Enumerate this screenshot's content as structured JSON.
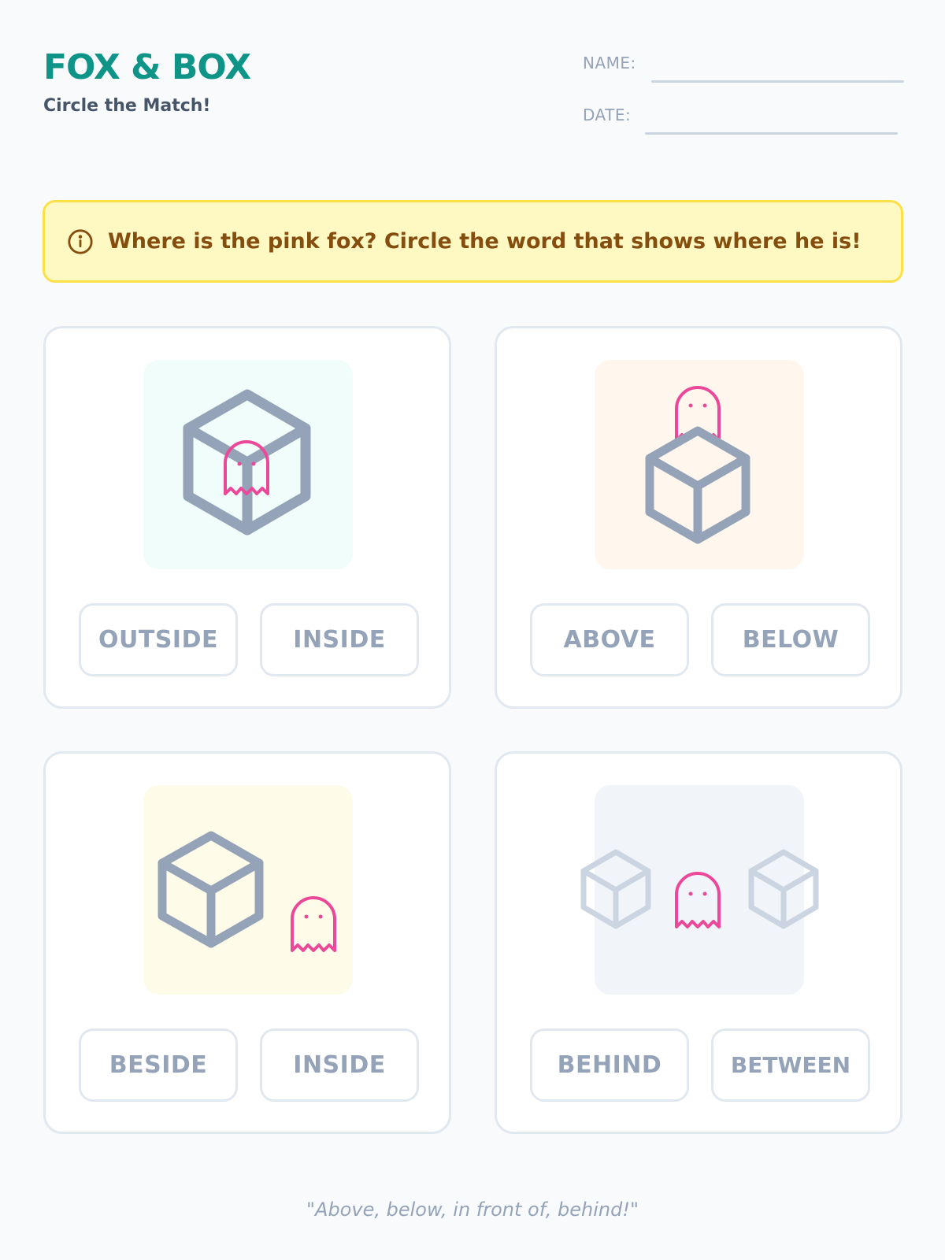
{
  "header": {
    "title": "FOX & BOX",
    "subtitle": "Circle the Match!"
  },
  "fields": {
    "name_label": "NAME:",
    "date_label": "DATE:"
  },
  "banner": {
    "icon": "info-icon",
    "text": "Where is the pink fox? Circle the word that shows where he is!"
  },
  "cards": [
    {
      "scene_color": "#f0fdfa",
      "options": [
        "OUTSIDE",
        "INSIDE"
      ]
    },
    {
      "scene_color": "#fff7ed",
      "options": [
        "ABOVE",
        "BELOW"
      ]
    },
    {
      "scene_color": "#fefce8",
      "options": [
        "BESIDE",
        "INSIDE"
      ]
    },
    {
      "scene_color": "#f1f5f9",
      "options": [
        "BEHIND",
        "BETWEEN"
      ]
    }
  ],
  "colors": {
    "accent": "#0f9488",
    "fox": "#ec4899",
    "box": "#94a3b8",
    "box_faded": "#cbd5e1",
    "banner_bg": "#fef9c3",
    "banner_border": "#fde047"
  },
  "footer": {
    "text": "\"Above, below, in front of, behind!\""
  }
}
